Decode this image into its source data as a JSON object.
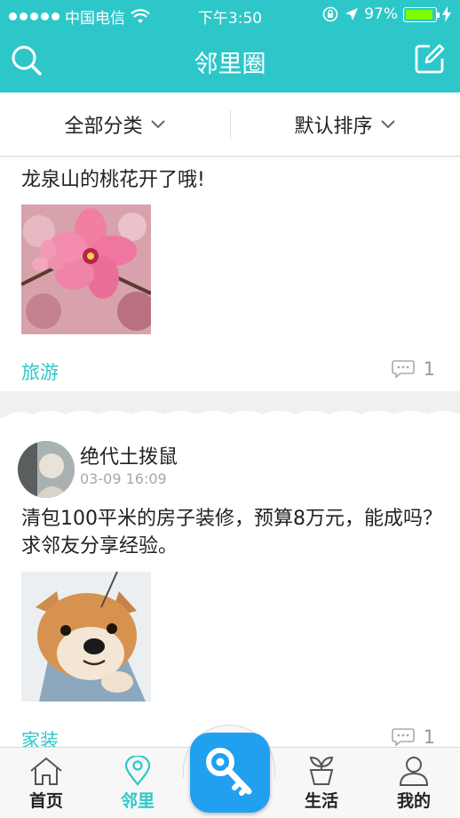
{
  "status": {
    "carrier": "中国电信",
    "time": "下午3:50",
    "battery": "97%",
    "battery_level": 0.97
  },
  "nav": {
    "title": "邻里圈"
  },
  "filters": {
    "category": "全部分类",
    "sort": "默认排序"
  },
  "posts": [
    {
      "text": "龙泉山的桃花开了哦!",
      "tag": "旅游",
      "comment_count": "1"
    },
    {
      "author": "绝代土拨鼠",
      "time": "03-09 16:09",
      "text": "清包100平米的房子装修，预算8万元，能成吗？求邻友分享经验。",
      "tag": "家装",
      "comment_count": "1"
    }
  ],
  "tabs": [
    {
      "label": "首页",
      "icon": "home-icon"
    },
    {
      "label": "邻里",
      "icon": "location-pin-icon",
      "active": true
    },
    {
      "label": "",
      "icon": "key-icon"
    },
    {
      "label": "生活",
      "icon": "plant-pot-icon"
    },
    {
      "label": "我的",
      "icon": "user-icon"
    }
  ],
  "colors": {
    "accent": "#2ec7c9",
    "key_button": "#21a0f0"
  }
}
